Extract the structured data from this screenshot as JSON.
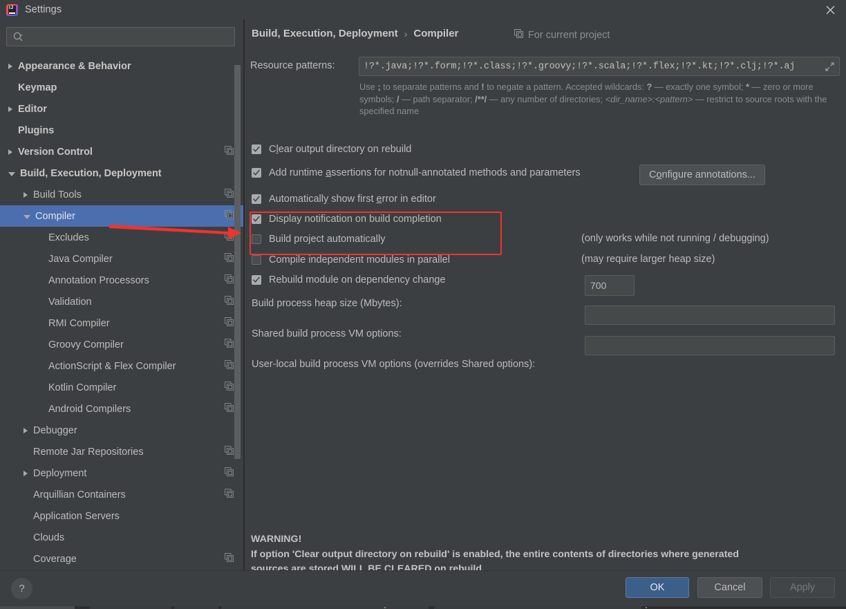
{
  "window": {
    "title": "Settings",
    "logo_text": "IJ",
    "close_icon": "close-icon"
  },
  "sidebar": {
    "search": {
      "value": "",
      "placeholder": "",
      "icon": "search-icon"
    },
    "items": [
      {
        "label": "Appearance & Behavior",
        "arrow": "right",
        "indent": 0,
        "bold": true,
        "cfg": false,
        "selected": false
      },
      {
        "label": "Keymap",
        "arrow": "none",
        "indent": 0,
        "bold": true,
        "cfg": false,
        "selected": false
      },
      {
        "label": "Editor",
        "arrow": "right",
        "indent": 0,
        "bold": true,
        "cfg": false,
        "selected": false
      },
      {
        "label": "Plugins",
        "arrow": "none",
        "indent": 0,
        "bold": true,
        "cfg": false,
        "selected": false
      },
      {
        "label": "Version Control",
        "arrow": "right",
        "indent": 0,
        "bold": true,
        "cfg": true,
        "selected": false
      },
      {
        "label": "Build, Execution, Deployment",
        "arrow": "down",
        "indent": 0,
        "bold": true,
        "cfg": false,
        "selected": false
      },
      {
        "label": "Build Tools",
        "arrow": "right",
        "indent": 1,
        "bold": false,
        "cfg": true,
        "selected": false
      },
      {
        "label": "Compiler",
        "arrow": "down",
        "indent": 1,
        "bold": false,
        "cfg": true,
        "selected": true
      },
      {
        "label": "Excludes",
        "arrow": "none",
        "indent": 2,
        "bold": false,
        "cfg": true,
        "selected": false
      },
      {
        "label": "Java Compiler",
        "arrow": "none",
        "indent": 2,
        "bold": false,
        "cfg": true,
        "selected": false
      },
      {
        "label": "Annotation Processors",
        "arrow": "none",
        "indent": 2,
        "bold": false,
        "cfg": true,
        "selected": false
      },
      {
        "label": "Validation",
        "arrow": "none",
        "indent": 2,
        "bold": false,
        "cfg": true,
        "selected": false
      },
      {
        "label": "RMI Compiler",
        "arrow": "none",
        "indent": 2,
        "bold": false,
        "cfg": true,
        "selected": false
      },
      {
        "label": "Groovy Compiler",
        "arrow": "none",
        "indent": 2,
        "bold": false,
        "cfg": true,
        "selected": false
      },
      {
        "label": "ActionScript & Flex Compiler",
        "arrow": "none",
        "indent": 2,
        "bold": false,
        "cfg": true,
        "selected": false
      },
      {
        "label": "Kotlin Compiler",
        "arrow": "none",
        "indent": 2,
        "bold": false,
        "cfg": true,
        "selected": false
      },
      {
        "label": "Android Compilers",
        "arrow": "none",
        "indent": 2,
        "bold": false,
        "cfg": true,
        "selected": false
      },
      {
        "label": "Debugger",
        "arrow": "right",
        "indent": 1,
        "bold": false,
        "cfg": false,
        "selected": false
      },
      {
        "label": "Remote Jar Repositories",
        "arrow": "none",
        "indent": 1,
        "bold": false,
        "cfg": true,
        "selected": false
      },
      {
        "label": "Deployment",
        "arrow": "right",
        "indent": 1,
        "bold": false,
        "cfg": true,
        "selected": false
      },
      {
        "label": "Arquillian Containers",
        "arrow": "none",
        "indent": 1,
        "bold": false,
        "cfg": true,
        "selected": false
      },
      {
        "label": "Application Servers",
        "arrow": "none",
        "indent": 1,
        "bold": false,
        "cfg": false,
        "selected": false
      },
      {
        "label": "Clouds",
        "arrow": "none",
        "indent": 1,
        "bold": false,
        "cfg": false,
        "selected": false
      },
      {
        "label": "Coverage",
        "arrow": "none",
        "indent": 1,
        "bold": false,
        "cfg": true,
        "selected": false
      }
    ]
  },
  "header": {
    "breadcrumb_root": "Build, Execution, Deployment",
    "breadcrumb_sep": "›",
    "breadcrumb_leaf": "Compiler",
    "for_current_project": "For current project",
    "for_current_project_icon": "project-scope-icon"
  },
  "main": {
    "resource_patterns": {
      "label": "Resource patterns:",
      "value": "!?*.java;!?*.form;!?*.class;!?*.groovy;!?*.scala;!?*.flex;!?*.kt;!?*.clj;!?*.aj",
      "expand_icon": "expand-icon"
    },
    "hint_line1_a": "Use ",
    "hint_sep": ";",
    "hint_line1_b": " to separate patterns and ",
    "hint_bang": "!",
    "hint_line1_c": " to negate a pattern. Accepted wildcards: ",
    "hint_q": "?",
    "hint_line1_d": " — exactly one symbol; ",
    "hint_star": "*",
    "hint_line1_e": " — zero or more symbols; ",
    "hint_slash": "/",
    "hint_line2_a": " — path separator; ",
    "hint_slashstar": "/**/",
    "hint_line2_b": " — any number of directories; ",
    "hint_dirname": "<dir_name>:<pattern>",
    "hint_line2_c": " — restrict to source roots with the specified name",
    "checkboxes": [
      {
        "label_pre": "C",
        "mnemonic": "l",
        "label_post": "ear output directory on rebuild",
        "checked": true
      },
      {
        "label_pre": "Add runtime ",
        "mnemonic": "a",
        "label_post": "ssertions for notnull-annotated methods and parameters",
        "checked": true
      },
      {
        "label_pre": "Automatically show first ",
        "mnemonic": "e",
        "label_post": "rror in editor",
        "checked": true
      },
      {
        "label_pre": "Display notification on build completion",
        "mnemonic": "",
        "label_post": "",
        "checked": true
      },
      {
        "label_pre": "Build project automatically",
        "mnemonic": "",
        "label_post": "",
        "checked": false
      },
      {
        "label_pre": "Compile independent modules in parallel",
        "mnemonic": "",
        "label_post": "",
        "checked": false
      },
      {
        "label_pre": "Rebuild module on dependency change",
        "mnemonic": "",
        "label_post": "",
        "checked": true
      }
    ],
    "configure_annotations_pre": "C",
    "configure_annotations_mn": "o",
    "configure_annotations_post": "nfigure annotations...",
    "note_running": "(only works while not running / debugging)",
    "note_heap": "(may require larger heap size)",
    "heap_label": "Build process heap size (Mbytes):",
    "heap_value": "700",
    "shared_vm_label": "Shared build process VM options:",
    "shared_vm_value": "",
    "user_vm_label": "User-local build process VM options (overrides Shared options):",
    "user_vm_value": "",
    "warning_title": "WARNING!",
    "warning_line1": "If option 'Clear output directory on rebuild' is enabled, the entire contents of directories where generated",
    "warning_line2": "sources are stored WILL BE CLEARED on rebuild."
  },
  "footer": {
    "help": "?",
    "ok": "OK",
    "cancel": "Cancel",
    "apply": "Apply"
  },
  "annotation": {
    "highlight_color": "#f2322e",
    "arrow_color": "#f2322e"
  },
  "colors": {
    "background": "#3c3f41",
    "selection": "#4b6eaf",
    "ok_button": "#3c5f8a",
    "text": "#bbbbbb"
  }
}
